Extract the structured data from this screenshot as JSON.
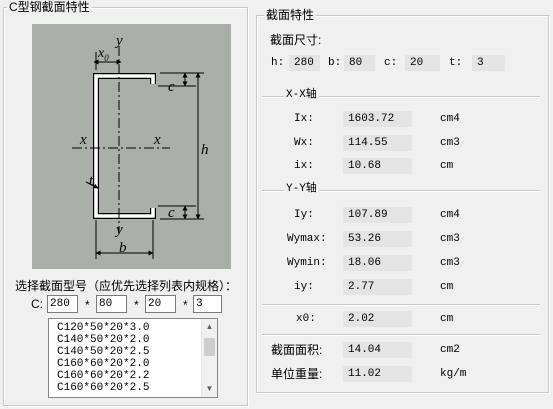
{
  "left_group": {
    "title": "C型钢截面特性"
  },
  "diagram": {
    "labels": {
      "y_top": "y",
      "x0": "x",
      "x0_sub": "0",
      "c_top": "c",
      "x_left": "x",
      "x_right": "x",
      "h": "h",
      "t": "t",
      "c_bottom": "c",
      "y_bottom": "y",
      "b": "b"
    },
    "colors": {
      "background": "#a8b0a8",
      "lines": "#000000",
      "section": "#ffffff"
    }
  },
  "selector": {
    "prompt": "选择截面型号（应优先选择列表内规格）：",
    "c_label": "C:",
    "h_value": "280",
    "b_value": "80",
    "c_value": "20",
    "t_value": "3",
    "sep": "*"
  },
  "section_list": {
    "items": [
      "C120*50*20*3.0",
      "C140*50*20*2.0",
      "C140*50*20*2.5",
      "C160*60*20*2.0",
      "C160*60*20*2.2",
      "C160*60*20*2.5"
    ]
  },
  "right_group": {
    "title": "截面特性",
    "size_label": "截面尺寸:",
    "dims": [
      {
        "label": "h:",
        "value": "280"
      },
      {
        "label": "b:",
        "value": "80"
      },
      {
        "label": "c:",
        "value": "20"
      },
      {
        "label": "t:",
        "value": "3"
      }
    ],
    "xx_title": "X-X轴",
    "xx": [
      {
        "label": "Ix:",
        "value": "1603.72",
        "unit": "cm4"
      },
      {
        "label": "Wx:",
        "value": "114.55",
        "unit": "cm3"
      },
      {
        "label": "ix:",
        "value": "10.68",
        "unit": "cm"
      }
    ],
    "yy_title": "Y-Y轴",
    "yy": [
      {
        "label": "Iy:",
        "value": "107.89",
        "unit": "cm4"
      },
      {
        "label": "Wymax:",
        "value": "53.26",
        "unit": "cm3"
      },
      {
        "label": "Wymin:",
        "value": "18.06",
        "unit": "cm3"
      },
      {
        "label": "iy:",
        "value": "2.77",
        "unit": "cm"
      }
    ],
    "x0": {
      "label": "x0:",
      "value": "2.02",
      "unit": "cm"
    },
    "area": {
      "label": "截面面积:",
      "value": "14.04",
      "unit": "cm2"
    },
    "weight": {
      "label": "单位重量:",
      "value": "11.02",
      "unit": "kg/m"
    }
  }
}
